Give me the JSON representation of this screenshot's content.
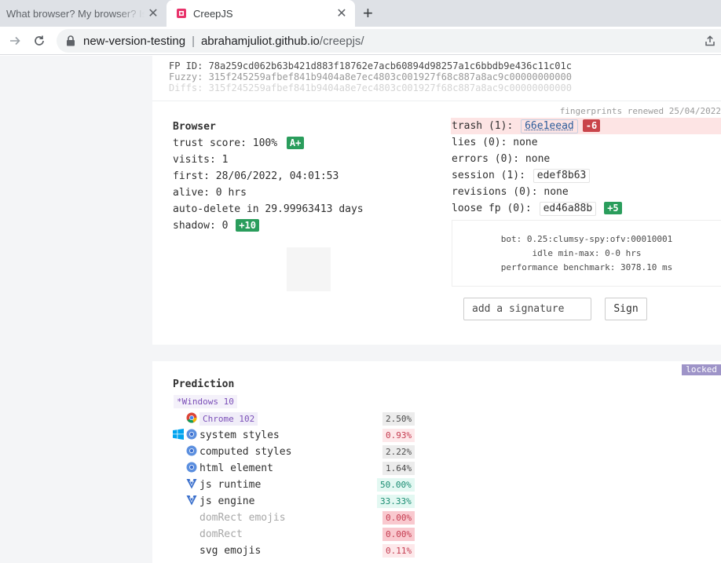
{
  "browser": {
    "tabs": [
      {
        "title": "What browser? My browser? Is",
        "active": false
      },
      {
        "title": "CreepJS",
        "active": true
      }
    ],
    "address": {
      "label": "new-version-testing",
      "separator": "|",
      "host": "abrahamjuliot.github.io",
      "path": "/creepjs/"
    }
  },
  "fingerprint": {
    "fp_id": "FP ID: 78a259cd062b63b421d883f18762e7acb60894d98257a1c6bbdb9e436c11c01c",
    "fuzzy": "Fuzzy: 315f245259afbef841b9404a8e7ec4803c001927f68c887a8ac9c00000000000",
    "diffs": "Diffs: 315f245259afbef841b9404a8e7ec4803c001927f68c887a8ac9c00000000000"
  },
  "browser_card": {
    "renewed": "fingerprints renewed 25/04/2022",
    "heading": "Browser",
    "trust_label": "trust score: 100%",
    "trust_grade": "A+",
    "visits": "visits: 1",
    "first": "first: 28/06/2022, 04:01:53",
    "alive": "alive: 0 hrs",
    "auto_delete": "auto-delete in 29.99963413 days",
    "shadow_label": "shadow: 0",
    "shadow_badge": "+10",
    "trash_label": "trash (1):",
    "trash_hash": "66e1eead",
    "trash_badge": "-6",
    "lies": "lies (0): none",
    "errors": "errors (0): none",
    "session_label": "session (1):",
    "session_hash": "edef8b63",
    "revisions": "revisions (0): none",
    "loose_label": "loose fp (0):",
    "loose_hash": "ed46a88b",
    "loose_badge": "+5",
    "bot": "bot: 0.25:clumsy-spy:ofv:00010001",
    "idle": "idle min-max: 0-0 hrs",
    "perf": "performance benchmark: 3078.10 ms",
    "signature_placeholder": "add a signature",
    "sign_label": "Sign"
  },
  "prediction": {
    "locked": "locked",
    "title": "Prediction",
    "os": "*Windows 10",
    "rows": [
      {
        "label": "Chrome 102",
        "pct": "2.50%"
      },
      {
        "label": "system styles",
        "pct": "0.93%"
      },
      {
        "label": "computed styles",
        "pct": "2.22%"
      },
      {
        "label": "html element",
        "pct": "1.64%"
      },
      {
        "label": "js runtime",
        "pct": "50.00%"
      },
      {
        "label": "js engine",
        "pct": "33.33%"
      },
      {
        "label": "domRect emojis",
        "pct": "0.00%"
      },
      {
        "label": "domRect",
        "pct": "0.00%"
      },
      {
        "label": "svg emojis",
        "pct": "0.11%"
      }
    ]
  },
  "colors": {
    "accent_green": "#2a9d5c",
    "accent_red": "#c9444a",
    "locked_purple": "#9e94c8"
  },
  "icons": [
    "creepjs-favicon",
    "chrome-icon",
    "windows-icon",
    "v8-icon",
    "lock-icon",
    "share-icon"
  ]
}
